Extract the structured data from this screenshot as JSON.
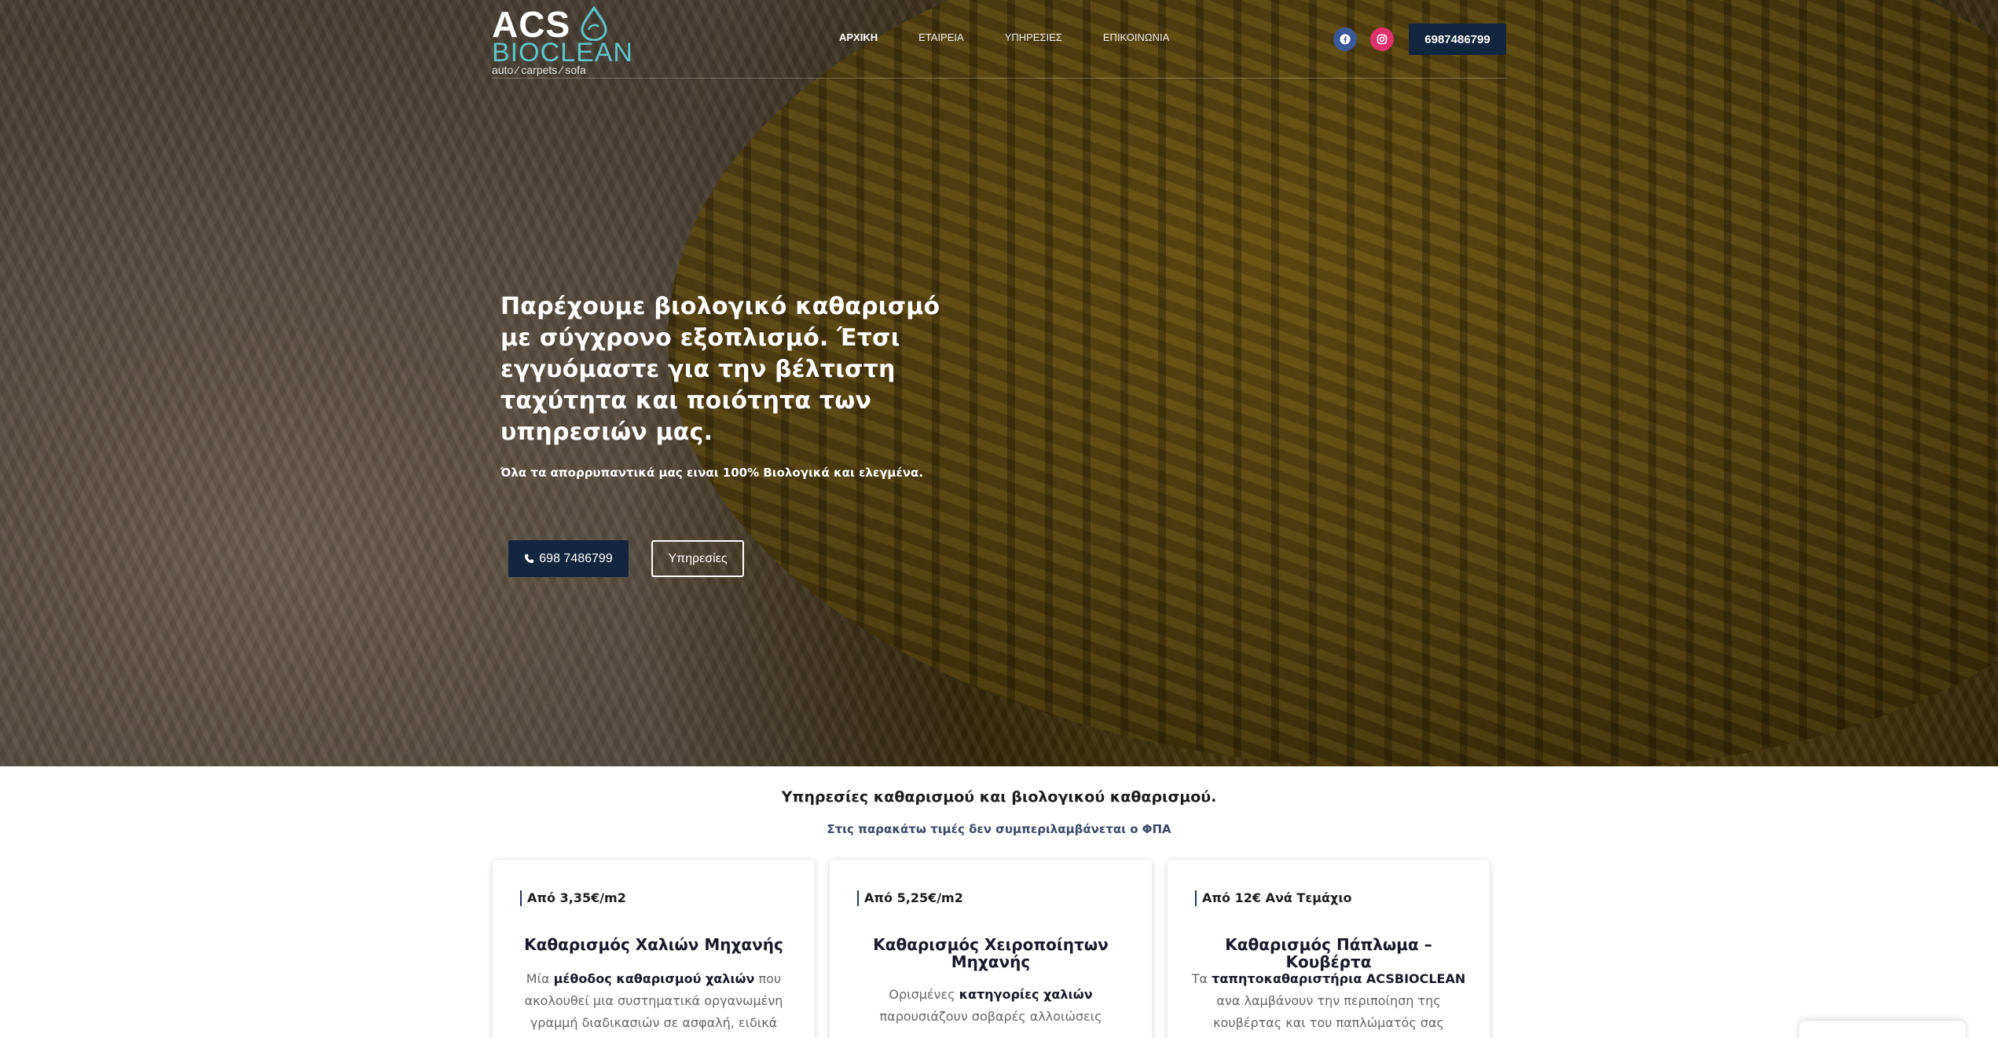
{
  "header": {
    "logo": {
      "acs": "ACS",
      "bioclean": "BIOCLEAN",
      "tagline": "auto ⁄ carpets ⁄ sofa"
    },
    "nav": [
      {
        "label": "ΑΡΧΙΚΗ",
        "active": true
      },
      {
        "label": "ΕΤΑΙΡΕΙΑ",
        "active": false
      },
      {
        "label": "ΥΠΗΡΕΣΙΕΣ",
        "active": false
      },
      {
        "label": "ΕΠΙΚΟΙΝΩΝΙΑ",
        "active": false
      }
    ],
    "social": {
      "facebook_icon": "facebook-icon",
      "instagram_icon": "instagram-icon"
    },
    "phone_button": "6987486799"
  },
  "hero": {
    "title": "Παρέχουμε βιολογικό καθαρισμό με σύγχρονο εξοπλισμό. Έτσι εγγυόμαστε για την βέλτιστη ταχύτητα και ποιότητα των υπηρεσιών μας.",
    "subtitle": "Όλα τα απορρυπαντικά μας ειναι 100% Βιολογικά και ελεγμένα.",
    "call_button": "698 7486799",
    "services_button": "Υπηρεσίες"
  },
  "services": {
    "title": "Υπηρεσίες καθαρισμού και βιολογικού καθαρισμού.",
    "note": "Στις παρακάτω τιμές δεν συμπεριλαμβάνεται ο ΦΠΑ",
    "cards": [
      {
        "price": "Από 3,35€/m2",
        "title": "Καθαρισμός Χαλιών Μηχανής",
        "desc_pre": "Μία ",
        "desc_bold": "μέθοδος καθαρισμού χαλιών",
        "desc_post": " που ακολουθεί μια συστηματικά οργανωμένη γραμμή διαδικασιών σε ασφαλή, ειδικά"
      },
      {
        "price": "Από 5,25€/m2",
        "title": "Καθαρισμός Χειροποίητων Μηχανής",
        "desc_pre": "Ορισμένες ",
        "desc_bold": "κατηγορίες χαλιών",
        "desc_post": " παρουσιάζουν σοβαρές αλλοιώσεις"
      },
      {
        "price": "Από 12€ Ανά Τεμάχιο",
        "title": "Καθαρισμός Πάπλωμα – Κουβέρτα",
        "desc_pre": "Τα ",
        "desc_bold": "ταπητοκαθαριστήρια ACSBIOCLEAN",
        "desc_post": " ανα λαμβάνουν την περιποίηση της κουβέρτας και του παπλώματός σας εξασφαλίζοντας τον"
      }
    ]
  },
  "colors": {
    "navy": "#13263f",
    "teal": "#5cc6c9",
    "facebook": "#3b5998",
    "instagram": "#e1306c"
  }
}
